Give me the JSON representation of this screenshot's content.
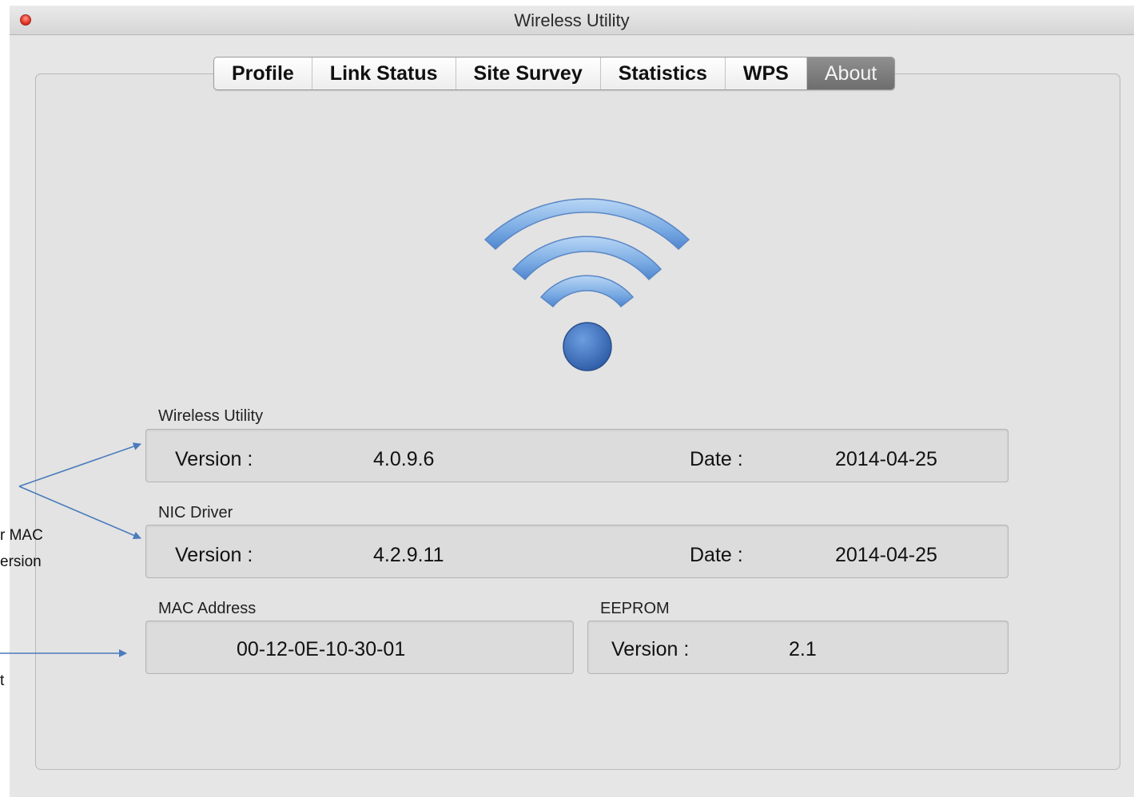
{
  "window": {
    "title": "Wireless Utility"
  },
  "tabs": [
    {
      "label": "Profile",
      "active": false
    },
    {
      "label": "Link Status",
      "active": false
    },
    {
      "label": "Site Survey",
      "active": false
    },
    {
      "label": "Statistics",
      "active": false
    },
    {
      "label": "WPS",
      "active": false
    },
    {
      "label": "About",
      "active": true
    }
  ],
  "about": {
    "logo_icon": "wifi-signal-icon",
    "wireless_utility": {
      "label": "Wireless Utility",
      "version_label": "Version :",
      "version": "4.0.9.6",
      "date_label": "Date :",
      "date": "2014-04-25"
    },
    "nic_driver": {
      "label": "NIC Driver",
      "version_label": "Version :",
      "version": "4.2.9.11",
      "date_label": "Date :",
      "date": "2014-04-25"
    },
    "mac_address": {
      "label": "MAC Address",
      "value": "00-12-0E-10-30-01"
    },
    "eeprom": {
      "label": "EEPROM",
      "version_label": "Version :",
      "version": "2.1"
    }
  },
  "annotations": {
    "line1": "r MAC",
    "line2": "ersion",
    "line3": "t"
  },
  "colors": {
    "wifi_arc": "#7fb0e6",
    "wifi_dot": "#3d6fb8",
    "arrow": "#4a7bbd",
    "active_tab": "#7a7a7a"
  }
}
